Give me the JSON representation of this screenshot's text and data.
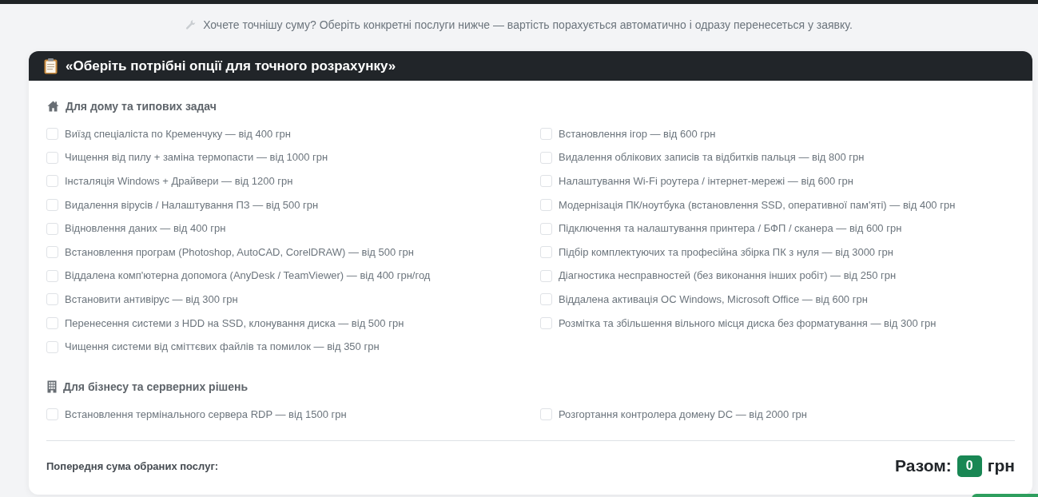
{
  "hint": {
    "text": "Хочете точнішу суму? Оберіть конкретні послуги нижче — вартість порахується автоматично і одразу перенесеться у заявку."
  },
  "card": {
    "title": "«Оберіть потрібні опції для точного розрахунку»",
    "sections": [
      {
        "kind": "home",
        "title": "Для дому та типових задач",
        "items": [
          {
            "label": "Виїзд спеціаліста по Кременчуку — від 400 грн",
            "checked": false
          },
          {
            "label": "Встановлення ігор — від 600 грн",
            "checked": false
          },
          {
            "label": "Чищення від пилу + заміна термопасти — від 1000 грн",
            "checked": false
          },
          {
            "label": "Видалення облікових записів та відбитків пальця — від 800 грн",
            "checked": false
          },
          {
            "label": "Інсталяція Windows + Драйвери — від 1200 грн",
            "checked": false
          },
          {
            "label": "Налаштування Wi-Fi роутера / інтернет-мережі — від 600 грн",
            "checked": false
          },
          {
            "label": "Видалення вірусів / Налаштування ПЗ — від 500 грн",
            "checked": false
          },
          {
            "label": "Модернізація ПК/ноутбука (встановлення SSD, оперативної пам'яті) — від 400 грн",
            "checked": false
          },
          {
            "label": "Відновлення даних — від 400 грн",
            "checked": false
          },
          {
            "label": "Підключення та налаштування принтера / БФП / сканера — від 600 грн",
            "checked": false
          },
          {
            "label": "Встановлення програм (Photoshop, AutoCAD, CorelDRAW) — від 500 грн",
            "checked": false
          },
          {
            "label": "Підбір комплектуючих та професійна збірка ПК з нуля — від 3000 грн",
            "checked": false
          },
          {
            "label": "Віддалена комп'ютерна допомога (AnyDesk / TeamViewer) — від 400 грн/год",
            "checked": false
          },
          {
            "label": "Діагностика несправностей (без виконання інших робіт) — від 250 грн",
            "checked": false
          },
          {
            "label": "Встановити антивірус — від 300 грн",
            "checked": false
          },
          {
            "label": "Віддалена активація ОС Windows, Microsoft Office — від 600 грн",
            "checked": false
          },
          {
            "label": "Перенесення системи з HDD на SSD, клонування диска — від 500 грн",
            "checked": false
          },
          {
            "label": "Розмітка та збільшення вільного місця диска без форматування — від 300 грн",
            "checked": false
          },
          {
            "label": "Чищення системи від сміттєвих файлів та помилок — від 350 грн",
            "checked": false
          }
        ]
      },
      {
        "kind": "business",
        "title": "Для бізнесу та серверних рішень",
        "items": [
          {
            "label": "Встановлення термінального сервера RDP — від 1500 грн",
            "checked": false
          },
          {
            "label": "Розгортання контролера домену DC — від 2000 грн",
            "checked": false
          }
        ]
      }
    ],
    "summary": {
      "label": "Попередня сума обраних послуг:",
      "total_label": "Разом:",
      "total": "0",
      "currency": "грн"
    }
  }
}
